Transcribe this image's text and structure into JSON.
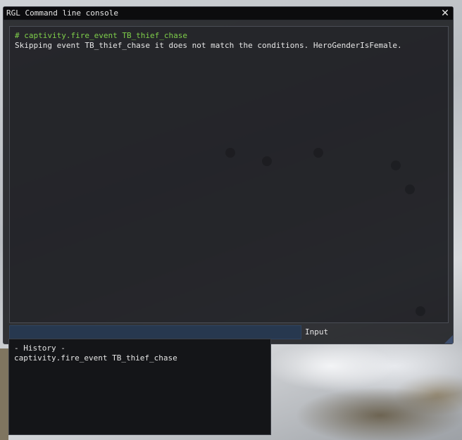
{
  "window": {
    "title": "RGL Command line console",
    "close_glyph": "✕"
  },
  "output": {
    "lines": [
      {
        "kind": "command",
        "text": "# captivity.fire_event TB_thief_chase"
      },
      {
        "kind": "message",
        "text": "Skipping event TB_thief_chase it does not match the conditions. HeroGenderIsFemale."
      }
    ]
  },
  "input": {
    "value": "",
    "label": "Input"
  },
  "history": {
    "header": "- History -",
    "items": [
      "captivity.fire_event TB_thief_chase"
    ]
  },
  "colors": {
    "command_text": "#7fcf4a",
    "message_text": "#e6e6e6",
    "input_background": "#27384f"
  }
}
